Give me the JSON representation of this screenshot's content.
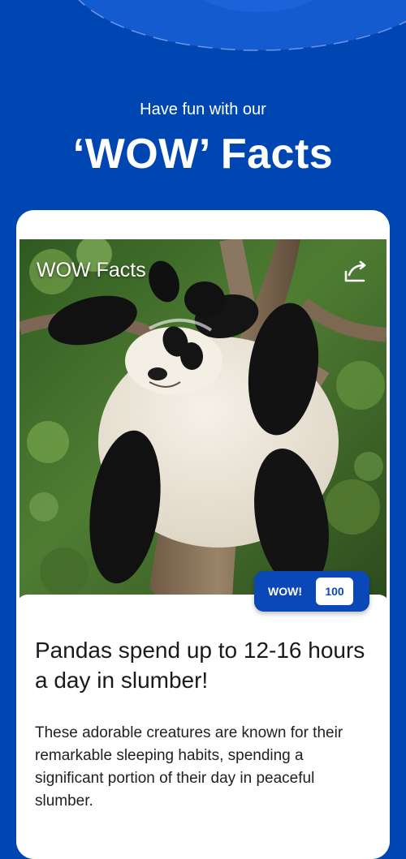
{
  "header": {
    "subtitle": "Have fun with our",
    "title": "‘WOW’ Facts"
  },
  "card": {
    "photo_title": "WOW Facts",
    "photo_subject": "Giant panda resting in a tree",
    "share_icon": "share-icon",
    "wow_label": "WOW!",
    "wow_count": "100",
    "fact_title": "Pandas spend up to 12-16 hours a day in slumber!",
    "fact_body": "These adorable creatures are known for their remarkable sleeping habits, spending a significant portion of their day in peaceful slumber."
  },
  "colors": {
    "background": "#0046b3",
    "accent": "#0a48b8",
    "card": "#ffffff",
    "text": "#1a1a1a"
  }
}
